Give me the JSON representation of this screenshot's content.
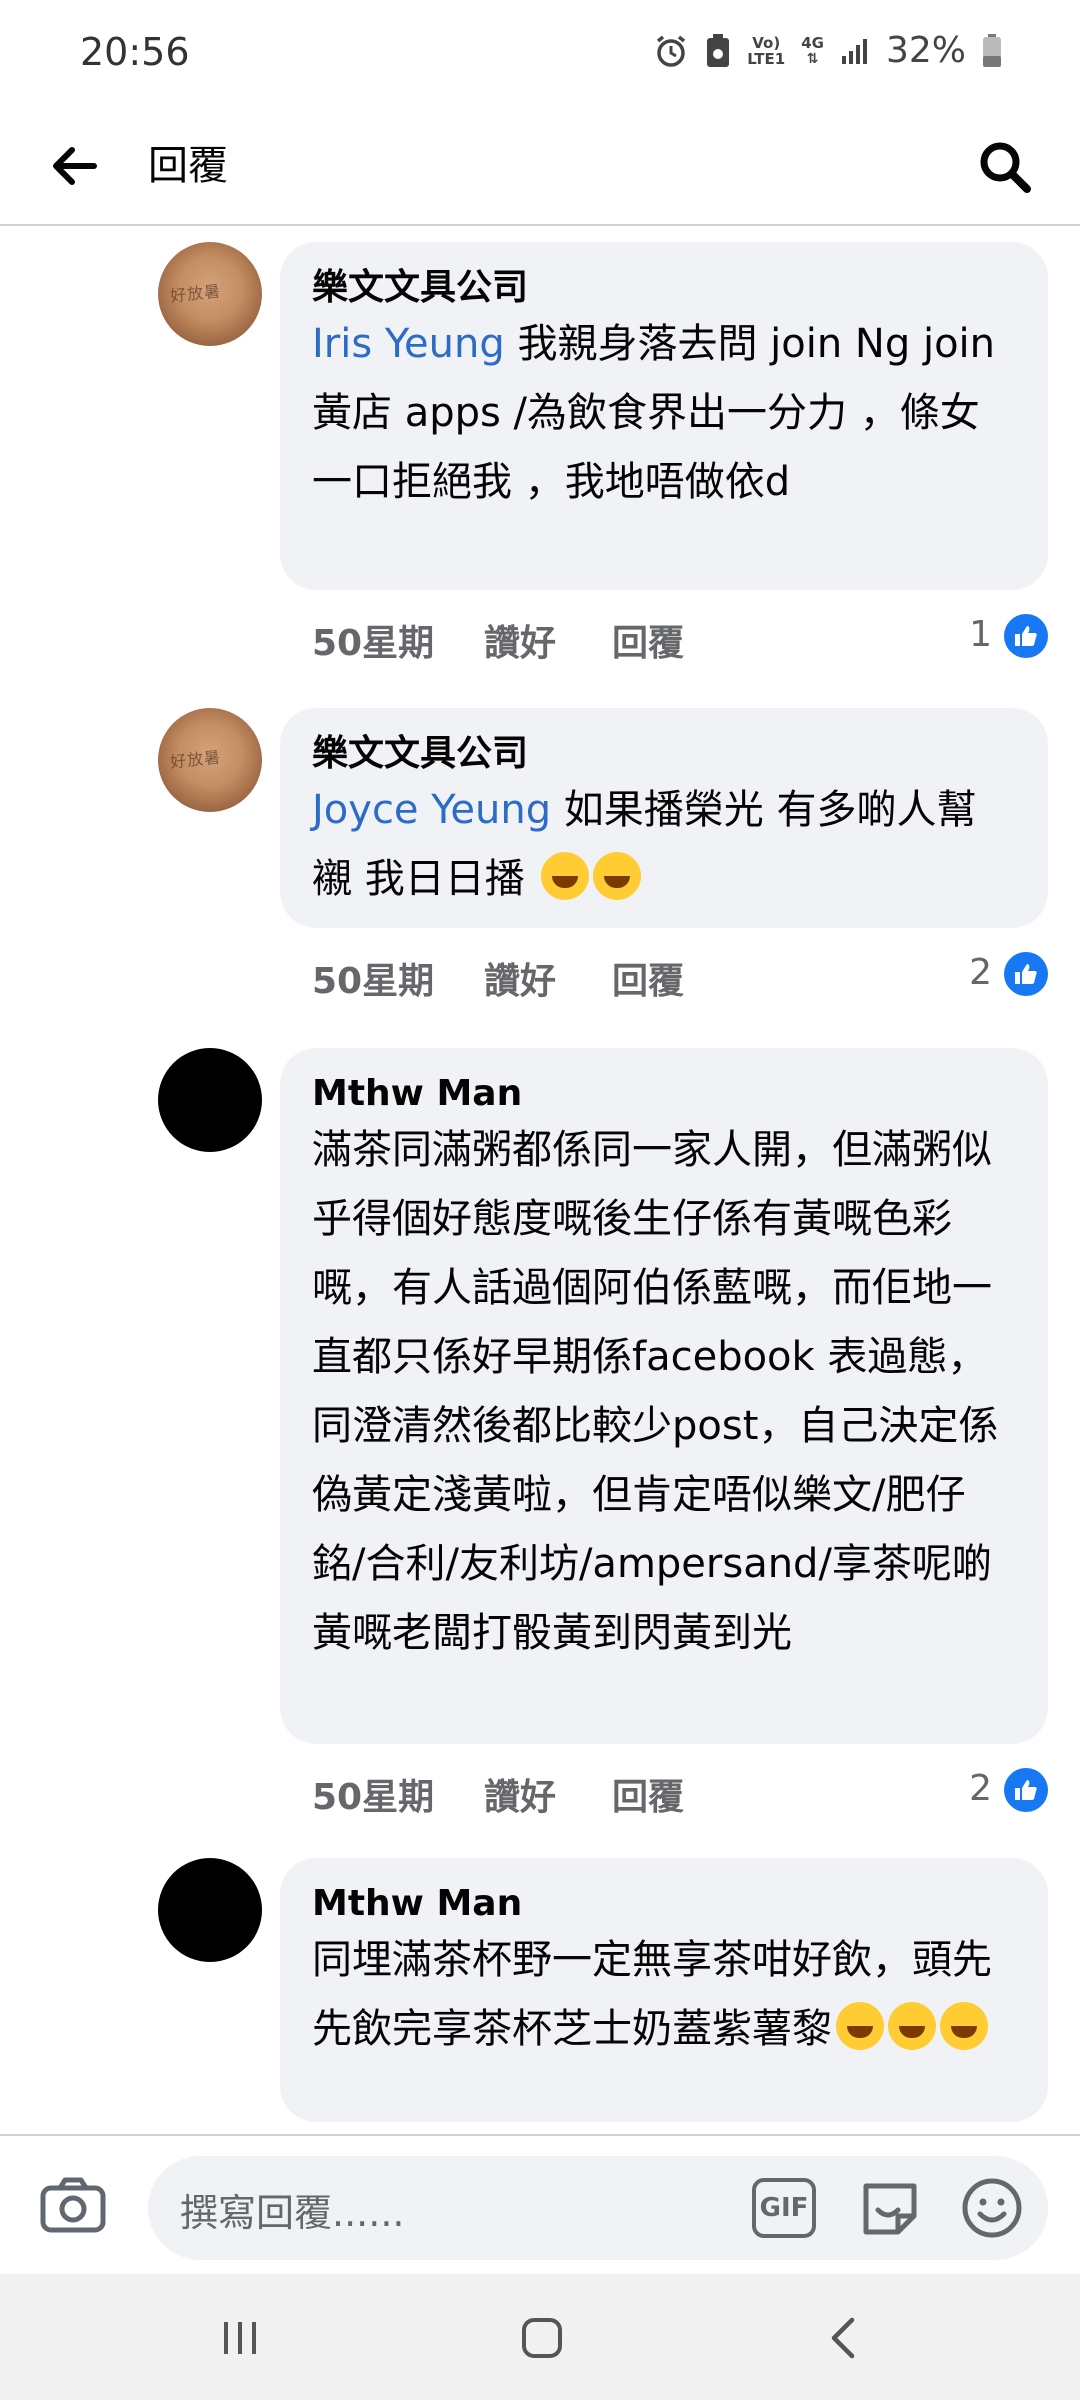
{
  "status_bar": {
    "time": "20:56",
    "network_top": "Vo)",
    "network_bottom": "LTE1",
    "data_type": "4G",
    "battery": "32%"
  },
  "header": {
    "title": "回覆"
  },
  "comments": [
    {
      "name": "樂文文具公司",
      "mention": "Iris Yeung",
      "text": " 我親身落去問 join Ng join 黃店 apps /為飲食界出一分力 ，條女一口拒絕我 ，我地唔做依d",
      "time": "50星期",
      "like": "讚好",
      "reply": "回覆",
      "count": "1",
      "avatar_text": "好放暑"
    },
    {
      "name": "樂文文具公司",
      "mention": "Joyce Yeung",
      "text": " 如果播榮光 有多啲人幫襯 我日日播 ",
      "time": "50星期",
      "like": "讚好",
      "reply": "回覆",
      "count": "2",
      "avatar_text": "好放暑"
    },
    {
      "name": "Mthw Man",
      "mention": "",
      "text": "滿茶同滿粥都係同一家人開，但滿粥似乎得個好態度嘅後生仔係有黃嘅色彩嘅，有人話過個阿伯係藍嘅，而佢地一直都只係好早期係facebook 表過態，同澄清然後都比較少post，自己決定係偽黃定淺黃啦，但肯定唔似樂文/肥仔銘/合利/友利坊/ampersand/享茶呢啲黃嘅老闆打骰黃到閃黃到光",
      "time": "50星期",
      "like": "讚好",
      "reply": "回覆",
      "count": "2"
    },
    {
      "name": "Mthw Man",
      "mention": "",
      "text": "同埋滿茶杯野一定無享茶咁好飲，頭先先飲完享茶杯芝士奶蓋紫薯黎",
      "time": "",
      "like": "",
      "reply": "",
      "count": ""
    }
  ],
  "composer": {
    "placeholder": "撰寫回覆......",
    "gif_label": "GIF"
  },
  "icons": {
    "back": "arrow-left-icon",
    "search": "search-icon",
    "camera": "camera-icon",
    "sticker": "sticker-icon",
    "emoji": "smiley-icon",
    "like_badge": "thumbs-up-icon",
    "nav_recents": "recents-icon",
    "nav_home": "home-icon",
    "nav_back": "back-chevron-icon"
  },
  "colors": {
    "mention": "#2d6cc6",
    "bubble": "#f0f2f5",
    "like_badge": "#1877f2",
    "meta_text": "#65676b"
  }
}
